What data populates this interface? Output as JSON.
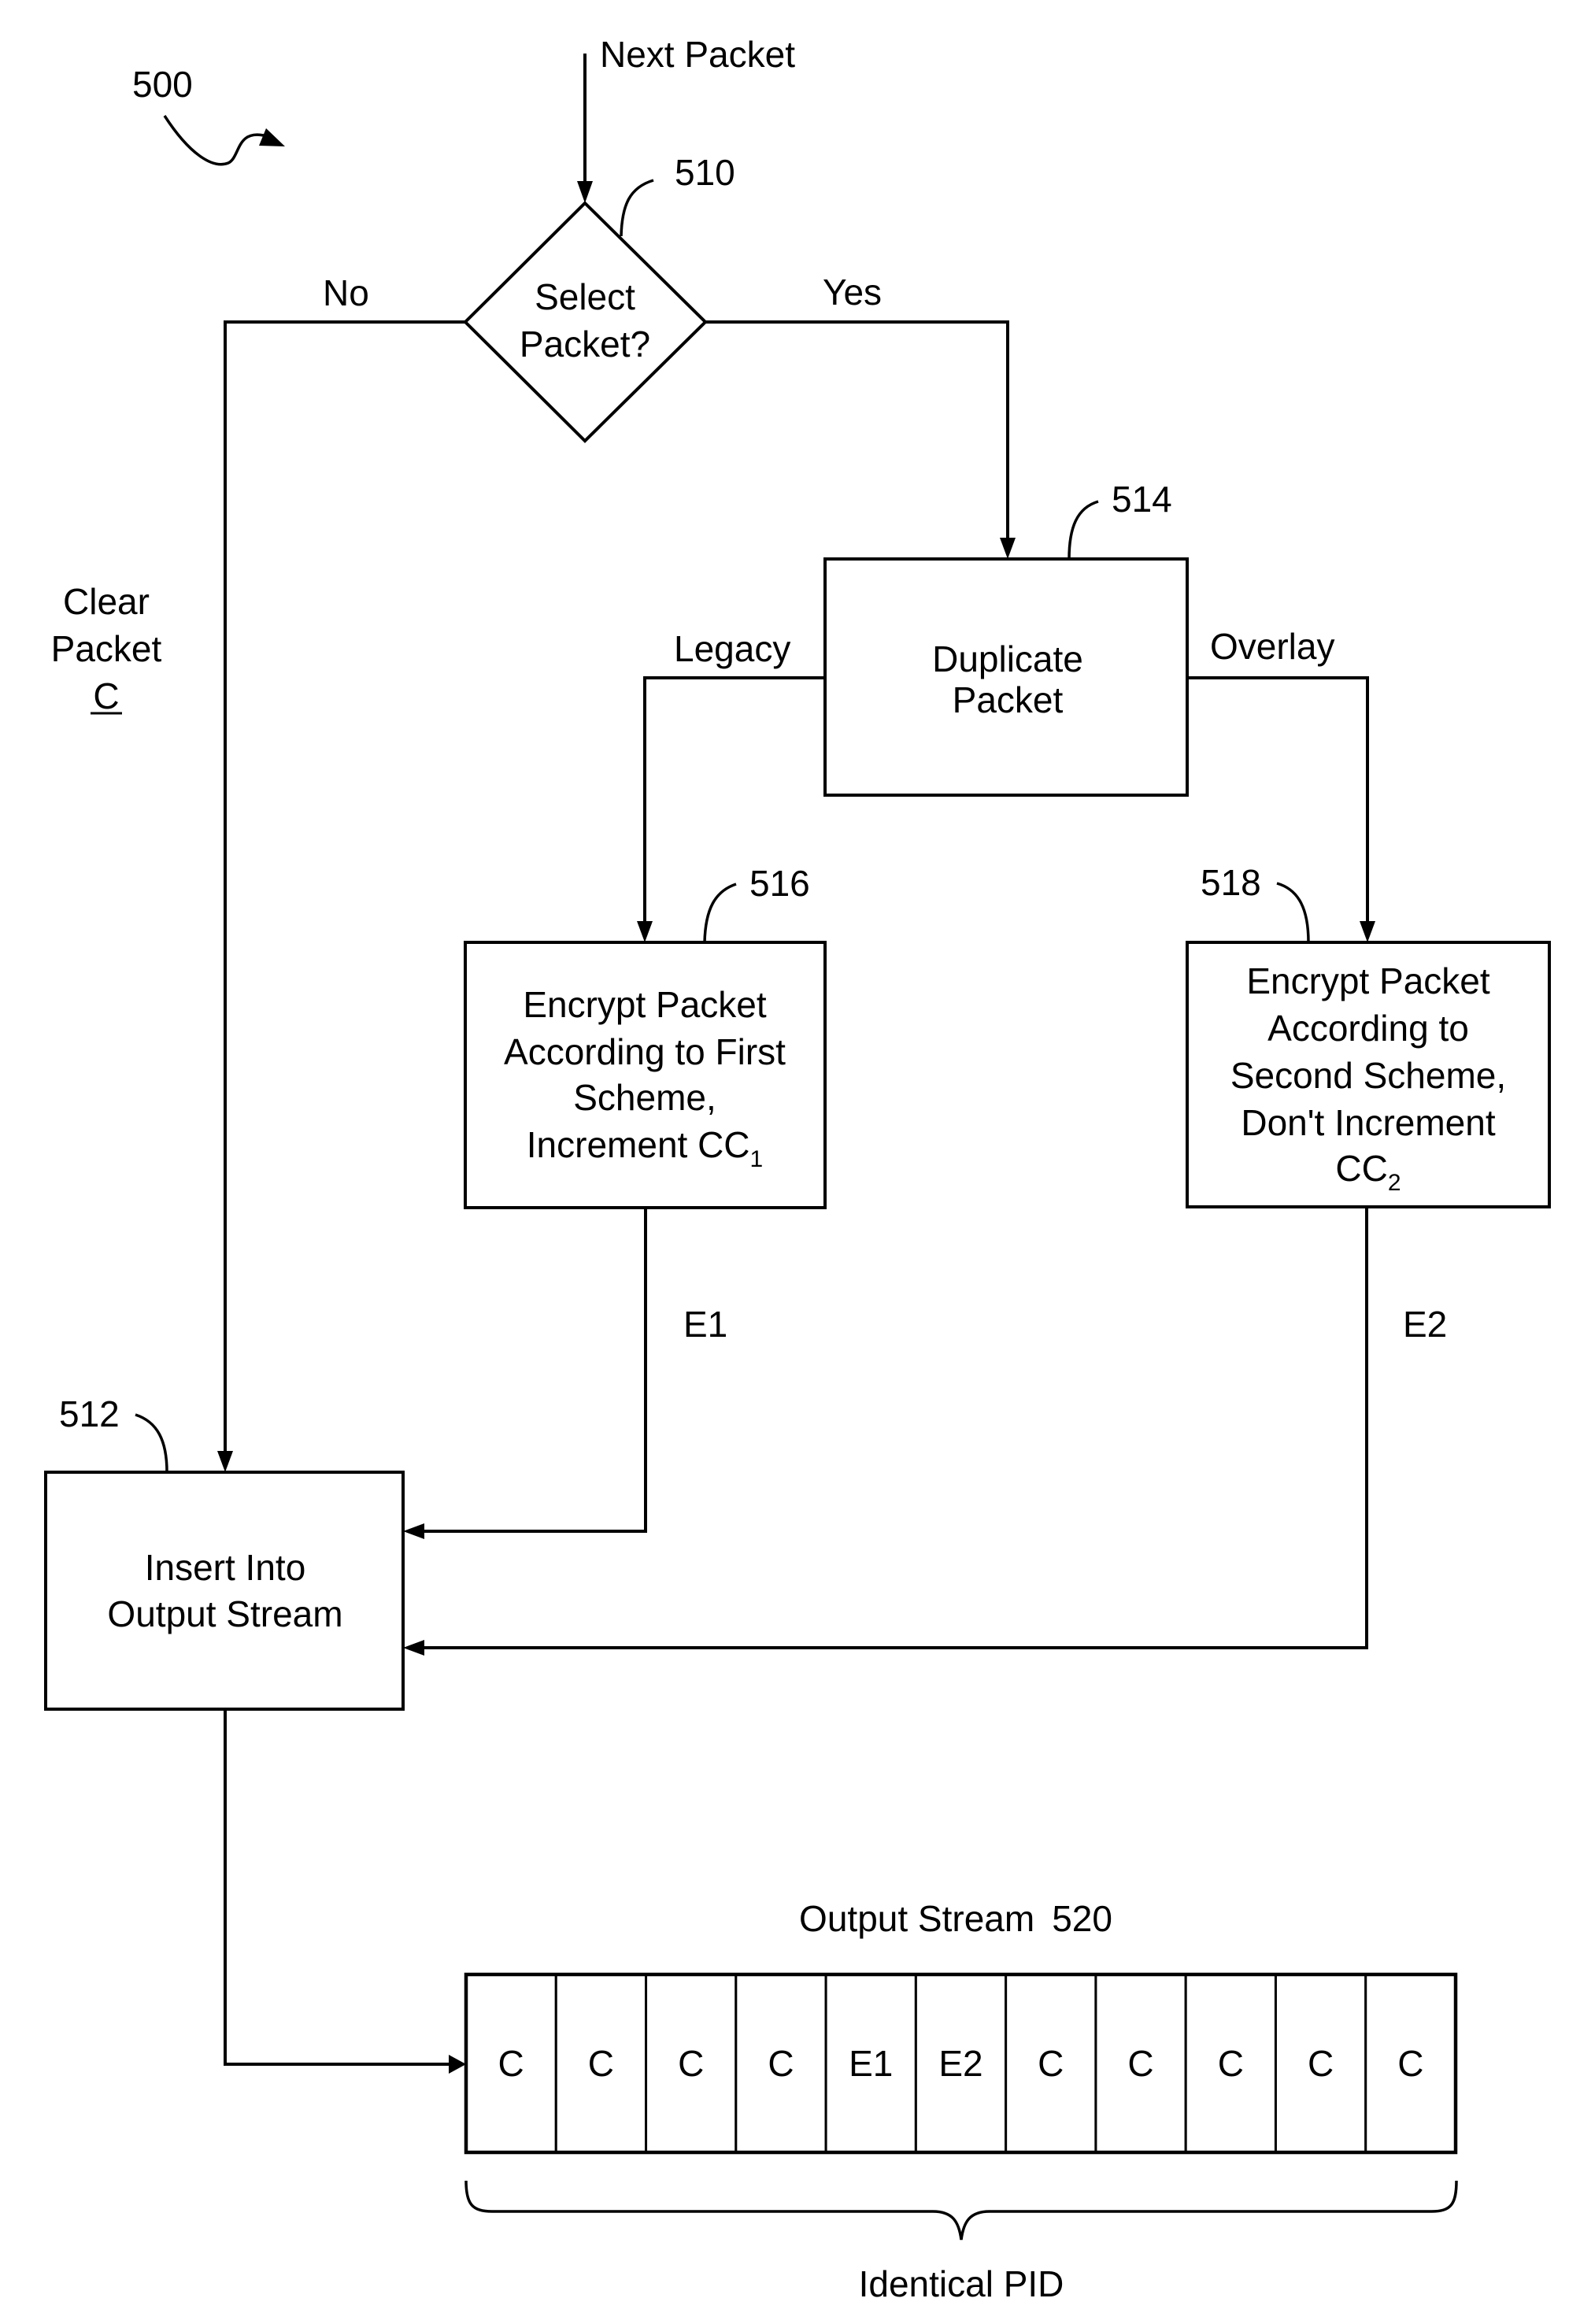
{
  "figure": {
    "ref": "500",
    "input_label": "Next Packet"
  },
  "decision": {
    "ref": "510",
    "lines": [
      "Select",
      "Packet?"
    ],
    "no_label": "No",
    "yes_label": "Yes"
  },
  "clear_branch": {
    "lines": [
      "Clear",
      "Packet"
    ],
    "symbol": "C"
  },
  "duplicate": {
    "ref": "514",
    "lines": [
      "Duplicate",
      "Packet"
    ],
    "left_label": "Legacy",
    "right_label": "Overlay"
  },
  "encrypt_first": {
    "ref": "516",
    "lines": [
      "Encrypt Packet",
      "According to First",
      "Scheme,",
      "Increment CC"
    ],
    "subscript": "1",
    "output_label": "E1"
  },
  "encrypt_second": {
    "ref": "518",
    "lines": [
      "Encrypt Packet",
      "According to",
      "Second Scheme,",
      "Don't Increment",
      "CC"
    ],
    "subscript": "2",
    "output_label": "E2"
  },
  "insert": {
    "ref": "512",
    "lines": [
      "Insert Into",
      "Output Stream"
    ]
  },
  "output_stream": {
    "title": "Output Stream",
    "ref": "520",
    "packets": [
      "C",
      "C",
      "C",
      "C",
      "E1",
      "E2",
      "C",
      "C",
      "C",
      "C",
      "C"
    ],
    "brace_label": "Identical PID"
  }
}
